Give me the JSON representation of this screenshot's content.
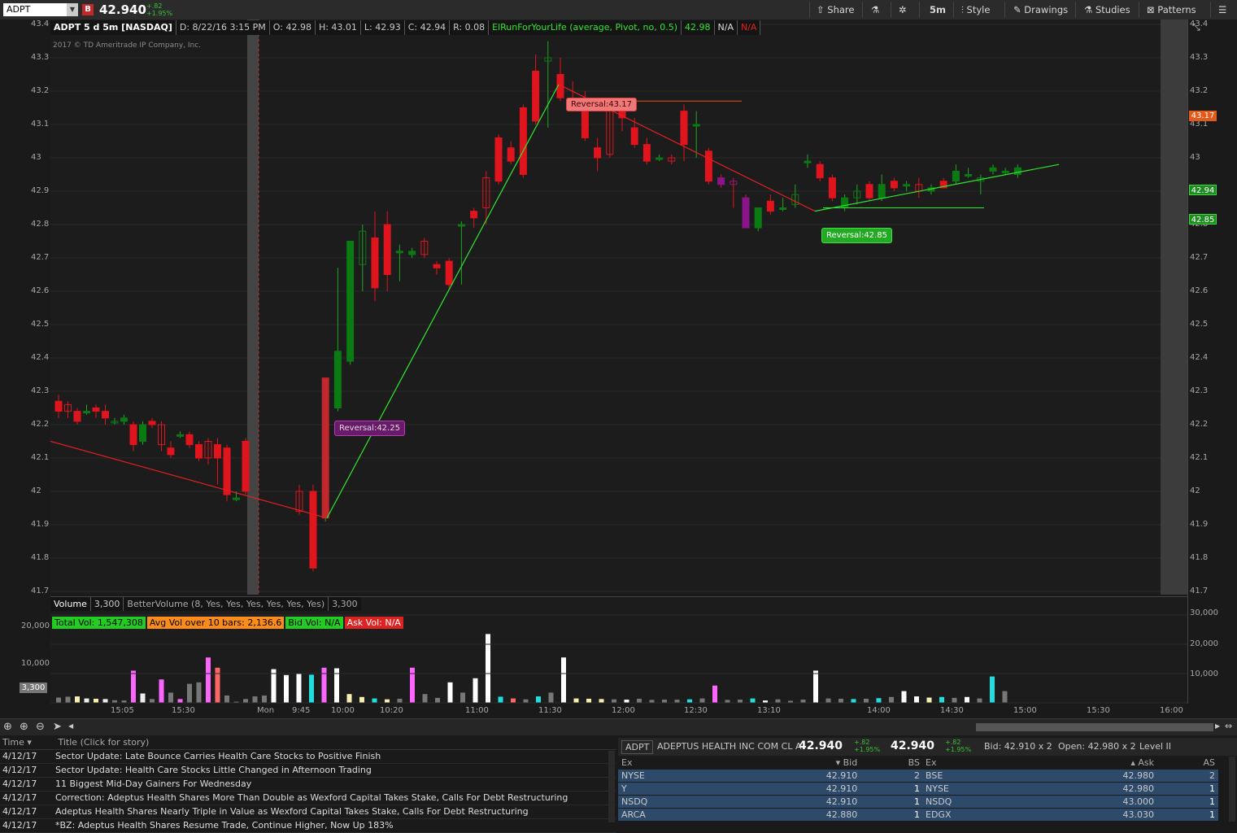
{
  "toolbar": {
    "symbol": "ADPT",
    "badge": "B",
    "last": "42.940",
    "change_abs": "+.82",
    "change_pct": "+1.95%",
    "share": "Share",
    "timeframe": "5m",
    "style": "Style",
    "drawings": "Drawings",
    "studies": "Studies",
    "patterns": "Patterns"
  },
  "infobar": {
    "title": "ADPT 5 d 5m [NASDAQ]",
    "date": "D: 8/22/16 3:15 PM",
    "open": "O: 42.98",
    "high": "H: 43.01",
    "low": "L: 42.93",
    "close": "C: 42.94",
    "range": "R: 0.08",
    "study": "ElRunForYourLife (average, Pivot, no, 0.5)",
    "study_val": "42.98",
    "na1": "N/A",
    "na2": "N/A"
  },
  "copyright": "2017 © TD Ameritrade IP Company, Inc.",
  "colors": {
    "up": "#0a7a12",
    "down": "#e0141c",
    "accent_green": "#2ee62e",
    "accent_red": "#e02020",
    "purple": "#8a148a"
  },
  "price_axis": [
    "43.4",
    "43.3",
    "43.2",
    "43.1",
    "43",
    "42.9",
    "42.8",
    "42.7",
    "42.6",
    "42.5",
    "42.4",
    "42.3",
    "42.2",
    "42.1",
    "42",
    "41.9",
    "41.8",
    "41.7"
  ],
  "price_tags": {
    "reversal_high": "43.17",
    "last": "42.94",
    "reversal_low": "42.85"
  },
  "annotations": {
    "rev1": "Reversal:43.17",
    "rev2": "Reversal:42.85",
    "rev3": "Reversal:42.25"
  },
  "volume": {
    "label": "Volume",
    "value": "3,300",
    "study": "BetterVolume (8, Yes, Yes, Yes, Yes, Yes, Yes)",
    "study_val": "3,300",
    "total": "Total Vol: 1,547,308",
    "avg": "Avg Vol over 10 bars: 2,136.6",
    "bid": "Bid Vol: N/A",
    "ask": "Ask Vol: N/A",
    "left_axis": [
      "20,000",
      "10,000"
    ],
    "right_axis": [
      "30,000",
      "20,000",
      "10,000"
    ],
    "tag": "3,300"
  },
  "time_axis": [
    "15:05",
    "15:30",
    "Mon",
    "9:45",
    "10:00",
    "10:20",
    "11:00",
    "11:30",
    "12:00",
    "12:30",
    "13:10",
    "14:00",
    "14:30",
    "15:00",
    "15:30",
    "16:00"
  ],
  "news": {
    "col_time": "Time",
    "col_title": "Title (Click for story)",
    "rows": [
      {
        "time": "4/12/17",
        "title": "Sector Update: Late Bounce Carries Health Care Stocks to Positive Finish"
      },
      {
        "time": "4/12/17",
        "title": "Sector Update: Health Care Stocks Little Changed in Afternoon Trading"
      },
      {
        "time": "4/12/17",
        "title": "11 Biggest Mid-Day Gainers For Wednesday"
      },
      {
        "time": "4/12/17",
        "title": "Correction: Adeptus Health Shares More Than Double as Wexford Capital Takes Stake, Calls For Debt Restructuring"
      },
      {
        "time": "4/12/17",
        "title": "Adeptus Health Shares Nearly Triple in Value as Wexford Capital Takes Stake, Calls For Debt Restructuring"
      },
      {
        "time": "4/12/17",
        "title": "*BZ: Adeptus Health Shares Resume Trade, Continue Higher, Now Up 183%"
      }
    ]
  },
  "level2": {
    "symbol": "ADPT",
    "company": "ADEPTUS HEALTH INC COM CL A",
    "bid_price": "42.940",
    "ask_price": "42.940",
    "chg1": "+.82",
    "chg2": "+1.95%",
    "bid": "Bid: 42.910 x 2",
    "open": "Open: 42.980 x 2",
    "level": "Level II",
    "bid_hdr": {
      "ex": "Ex",
      "bid": "Bid",
      "bs": "BS"
    },
    "ask_hdr": {
      "ex": "Ex",
      "ask": "Ask",
      "as": "AS"
    },
    "bids": [
      {
        "ex": "NYSE",
        "price": "42.910",
        "size": "2"
      },
      {
        "ex": "Y",
        "price": "42.910",
        "size": "1"
      },
      {
        "ex": "NSDQ",
        "price": "42.910",
        "size": "1"
      },
      {
        "ex": "ARCA",
        "price": "42.880",
        "size": "1"
      }
    ],
    "asks": [
      {
        "ex": "BSE",
        "price": "42.980",
        "size": "2"
      },
      {
        "ex": "NYSE",
        "price": "42.980",
        "size": "1"
      },
      {
        "ex": "NSDQ",
        "price": "43.000",
        "size": "1"
      },
      {
        "ex": "EDGX",
        "price": "43.030",
        "size": "1"
      }
    ]
  },
  "chart_data": {
    "type": "candlestick",
    "ylim": [
      41.7,
      43.4
    ],
    "candles": [
      {
        "o": 42.27,
        "h": 42.29,
        "l": 42.22,
        "c": 42.24
      },
      {
        "o": 42.26,
        "h": 42.27,
        "l": 42.22,
        "c": 42.24
      },
      {
        "o": 42.24,
        "h": 42.25,
        "l": 42.2,
        "c": 42.21
      },
      {
        "o": 42.24,
        "h": 42.26,
        "l": 42.23,
        "c": 42.24
      },
      {
        "o": 42.25,
        "h": 42.26,
        "l": 42.22,
        "c": 42.24
      },
      {
        "o": 42.24,
        "h": 42.26,
        "l": 42.2,
        "c": 42.22
      },
      {
        "o": 42.21,
        "h": 42.22,
        "l": 42.2,
        "c": 42.21
      },
      {
        "o": 42.21,
        "h": 42.23,
        "l": 42.2,
        "c": 42.22
      },
      {
        "o": 42.2,
        "h": 42.21,
        "l": 42.12,
        "c": 42.14
      },
      {
        "o": 42.15,
        "h": 42.21,
        "l": 42.14,
        "c": 42.2
      },
      {
        "o": 42.21,
        "h": 42.22,
        "l": 42.19,
        "c": 42.2
      },
      {
        "o": 42.2,
        "h": 42.21,
        "l": 42.12,
        "c": 42.14
      },
      {
        "o": 42.13,
        "h": 42.15,
        "l": 42.1,
        "c": 42.11
      },
      {
        "o": 42.17,
        "h": 42.18,
        "l": 42.16,
        "c": 42.17
      },
      {
        "o": 42.17,
        "h": 42.18,
        "l": 42.13,
        "c": 42.14
      },
      {
        "o": 42.14,
        "h": 42.15,
        "l": 42.09,
        "c": 42.1
      },
      {
        "o": 42.15,
        "h": 42.16,
        "l": 42.08,
        "c": 42.1
      },
      {
        "o": 42.14,
        "h": 42.16,
        "l": 42.02,
        "c": 42.1
      },
      {
        "o": 42.13,
        "h": 42.14,
        "l": 41.97,
        "c": 41.99
      },
      {
        "o": 41.98,
        "h": 42.0,
        "l": 41.97,
        "c": 41.98
      },
      {
        "o": 42.15,
        "h": 42.16,
        "l": 41.99,
        "c": 42.0
      },
      {
        "o": 42.0,
        "h": 42.02,
        "l": 41.93,
        "c": 41.94
      },
      {
        "o": 42.0,
        "h": 42.02,
        "l": 41.76,
        "c": 41.77
      },
      {
        "o": 41.92,
        "h": 42.34,
        "l": 41.91,
        "c": 42.34
      },
      {
        "o": 42.25,
        "h": 42.67,
        "l": 42.24,
        "c": 42.42
      },
      {
        "o": 42.39,
        "h": 42.72,
        "l": 42.38,
        "c": 42.75
      },
      {
        "o": 42.68,
        "h": 42.8,
        "l": 42.6,
        "c": 42.78
      },
      {
        "o": 42.76,
        "h": 42.84,
        "l": 42.57,
        "c": 42.61
      },
      {
        "o": 42.8,
        "h": 42.84,
        "l": 42.6,
        "c": 42.65
      },
      {
        "o": 42.72,
        "h": 42.74,
        "l": 42.63,
        "c": 42.72
      },
      {
        "o": 42.71,
        "h": 42.73,
        "l": 42.7,
        "c": 42.72
      },
      {
        "o": 42.75,
        "h": 42.76,
        "l": 42.7,
        "c": 42.71
      },
      {
        "o": 42.68,
        "h": 42.69,
        "l": 42.65,
        "c": 42.67
      },
      {
        "o": 42.69,
        "h": 42.7,
        "l": 42.61,
        "c": 42.62
      },
      {
        "o": 42.8,
        "h": 42.81,
        "l": 42.62,
        "c": 42.8
      },
      {
        "o": 42.84,
        "h": 42.85,
        "l": 42.79,
        "c": 42.82
      },
      {
        "o": 42.94,
        "h": 42.96,
        "l": 42.8,
        "c": 42.85
      },
      {
        "o": 43.06,
        "h": 43.07,
        "l": 42.92,
        "c": 42.93
      },
      {
        "o": 43.03,
        "h": 43.05,
        "l": 42.98,
        "c": 42.99
      },
      {
        "o": 43.15,
        "h": 43.16,
        "l": 42.94,
        "c": 42.95
      },
      {
        "o": 43.26,
        "h": 43.31,
        "l": 43.1,
        "c": 43.11
      },
      {
        "o": 43.29,
        "h": 43.35,
        "l": 43.09,
        "c": 43.3
      },
      {
        "o": 43.25,
        "h": 43.3,
        "l": 43.17,
        "c": 43.18
      },
      {
        "o": 43.17,
        "h": 43.23,
        "l": 43.14,
        "c": 43.16
      },
      {
        "o": 43.16,
        "h": 43.2,
        "l": 43.05,
        "c": 43.06
      },
      {
        "o": 43.03,
        "h": 43.06,
        "l": 42.96,
        "c": 43.0
      },
      {
        "o": 43.16,
        "h": 43.17,
        "l": 43.0,
        "c": 43.01
      },
      {
        "o": 43.16,
        "h": 43.17,
        "l": 43.08,
        "c": 43.12
      },
      {
        "o": 43.09,
        "h": 43.12,
        "l": 43.03,
        "c": 43.04
      },
      {
        "o": 43.04,
        "h": 43.06,
        "l": 42.98,
        "c": 42.99
      },
      {
        "o": 43.0,
        "h": 43.01,
        "l": 42.99,
        "c": 43.0
      },
      {
        "o": 43.0,
        "h": 43.01,
        "l": 42.98,
        "c": 42.99
      },
      {
        "o": 43.14,
        "h": 43.16,
        "l": 42.99,
        "c": 43.04
      },
      {
        "o": 43.1,
        "h": 43.14,
        "l": 43.0,
        "c": 43.1
      },
      {
        "o": 43.02,
        "h": 43.03,
        "l": 42.92,
        "c": 42.93
      },
      {
        "o": 42.94,
        "h": 42.95,
        "l": 42.91,
        "c": 42.92
      },
      {
        "o": 42.93,
        "h": 42.94,
        "l": 42.85,
        "c": 42.92
      },
      {
        "o": 42.88,
        "h": 42.89,
        "l": 42.8,
        "c": 42.79
      },
      {
        "o": 42.79,
        "h": 42.85,
        "l": 42.78,
        "c": 42.85
      },
      {
        "o": 42.87,
        "h": 42.89,
        "l": 42.83,
        "c": 42.84
      },
      {
        "o": 42.85,
        "h": 42.88,
        "l": 42.84,
        "c": 42.85
      },
      {
        "o": 42.86,
        "h": 42.92,
        "l": 42.85,
        "c": 42.89
      },
      {
        "o": 42.99,
        "h": 43.01,
        "l": 42.97,
        "c": 42.99
      },
      {
        "o": 42.98,
        "h": 42.99,
        "l": 42.93,
        "c": 42.94
      },
      {
        "o": 42.94,
        "h": 42.95,
        "l": 42.87,
        "c": 42.88
      },
      {
        "o": 42.85,
        "h": 42.89,
        "l": 42.84,
        "c": 42.88
      },
      {
        "o": 42.88,
        "h": 42.92,
        "l": 42.86,
        "c": 42.9
      },
      {
        "o": 42.92,
        "h": 42.93,
        "l": 42.87,
        "c": 42.88
      },
      {
        "o": 42.88,
        "h": 42.95,
        "l": 42.87,
        "c": 42.92
      },
      {
        "o": 42.93,
        "h": 42.94,
        "l": 42.9,
        "c": 42.91
      },
      {
        "o": 42.92,
        "h": 42.93,
        "l": 42.9,
        "c": 42.92
      },
      {
        "o": 42.92,
        "h": 42.94,
        "l": 42.88,
        "c": 42.9
      },
      {
        "o": 42.9,
        "h": 42.92,
        "l": 42.89,
        "c": 42.91
      },
      {
        "o": 42.93,
        "h": 42.94,
        "l": 42.91,
        "c": 42.91
      },
      {
        "o": 42.93,
        "h": 42.98,
        "l": 42.92,
        "c": 42.96
      },
      {
        "o": 42.95,
        "h": 42.97,
        "l": 42.94,
        "c": 42.95
      },
      {
        "o": 42.93,
        "h": 42.95,
        "l": 42.89,
        "c": 42.94
      },
      {
        "o": 42.96,
        "h": 42.98,
        "l": 42.95,
        "c": 42.97
      },
      {
        "o": 42.96,
        "h": 42.97,
        "l": 42.95,
        "c": 42.96
      },
      {
        "o": 42.95,
        "h": 42.98,
        "l": 42.94,
        "c": 42.97
      }
    ]
  }
}
